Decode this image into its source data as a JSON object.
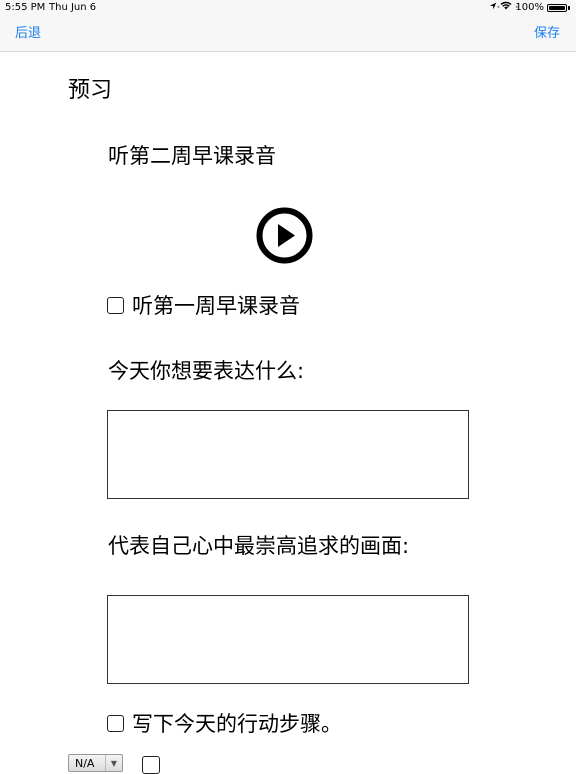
{
  "status_bar": {
    "time": "5:55 PM",
    "date": "Thu Jun 6",
    "battery": "100%",
    "battery_level": 1.0,
    "icons": [
      "wifi-icon",
      "location-icon",
      "battery-icon"
    ]
  },
  "nav": {
    "back_label": "后退",
    "save_label": "保存",
    "accent_color": "#1a7ff0"
  },
  "content": {
    "section_title": "预习",
    "listen_week2": "听第二周早课录音",
    "play_icon": "play-circle-icon",
    "listen_week1": "听第一周早课录音",
    "express_prompt": "今天你想要表达什么:",
    "express_value": "",
    "vision_prompt": "代表自己心中最崇高追求的画面:",
    "vision_value": "",
    "action_steps": "写下今天的行动步骤。",
    "select_value": "N/A"
  }
}
